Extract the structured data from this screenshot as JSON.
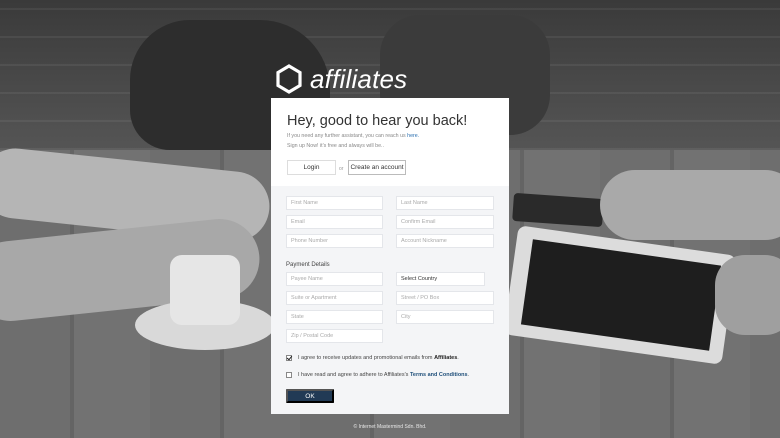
{
  "brand": {
    "name": "affiliates",
    "logo_icon": "hexagon-outline-icon",
    "colors": {
      "primary_button": "#213a55",
      "link": "#2a6fb0",
      "panel": "#f4f5f7"
    }
  },
  "header": {
    "title": "Hey, good to hear you back!",
    "subtitle_prefix": "If you need any further assistant, you can reach us",
    "subtitle_link": "here.",
    "subtitle2": "Sign up Now! it's free and always will be..",
    "login_label": "Login",
    "or_label": "or",
    "create_label": "Create an account"
  },
  "form": {
    "first_name": "First Name",
    "last_name": "Last Name",
    "email": "Email",
    "confirm_email": "Confirm Email",
    "phone": "Phone Number",
    "nickname": "Account Nickname",
    "payment_label": "Payment Details",
    "payee": "Payee Name",
    "country": "Select Country",
    "suite": "Suite or Apartment",
    "street": "Street / PO Box",
    "state": "State",
    "city": "City",
    "zip": "Zip / Postal Code"
  },
  "agreements": {
    "promo_text": "I agree to receive updates and promotional emails from",
    "promo_brand": "Affiliates",
    "promo_end": ".",
    "promo_checked": true,
    "terms_text": "I have read and agree to adhere to Affiliates's",
    "terms_link": "Terms and Conditions",
    "terms_end": ".",
    "terms_checked": false
  },
  "ok_label": "OK",
  "footer": "© Internet Mastermind Sdn. Bhd."
}
